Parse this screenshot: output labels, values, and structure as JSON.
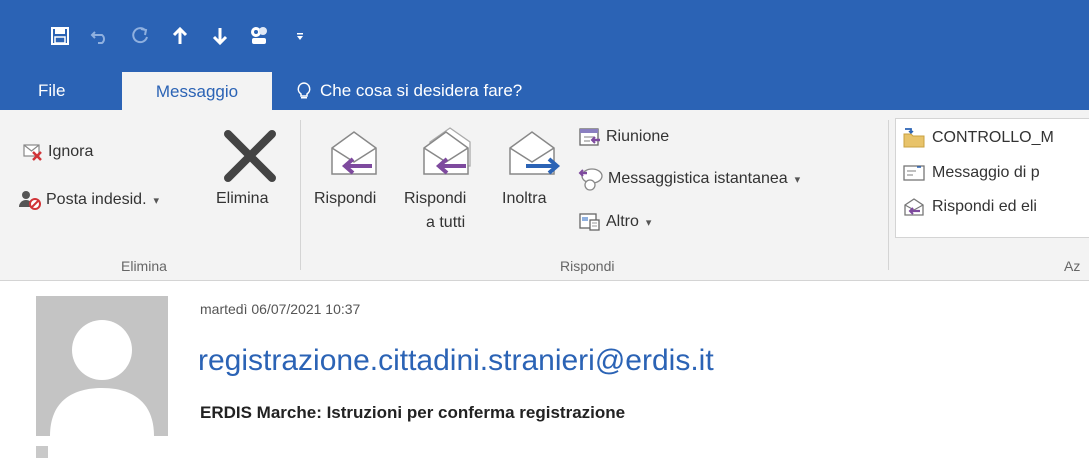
{
  "tabs": {
    "file": "File",
    "messaggio": "Messaggio",
    "tell_me": "Che cosa si desidera fare?"
  },
  "quick_access": [
    "save-icon",
    "undo-icon",
    "redo-icon",
    "arrow-up-icon",
    "arrow-down-icon",
    "touch-mode-icon",
    "customize-icon"
  ],
  "ribbon": {
    "elimina_group": {
      "ignora": "Ignora",
      "posta_indesiderata": "Posta indesid.",
      "elimina": "Elimina",
      "label": "Elimina"
    },
    "rispondi_group": {
      "rispondi": "Rispondi",
      "rispondi_a_tutti_line1": "Rispondi",
      "rispondi_a_tutti_line2": "a tutti",
      "inoltra": "Inoltra",
      "riunione": "Riunione",
      "messaggistica": "Messaggistica istantanea",
      "altro": "Altro",
      "label": "Rispondi"
    },
    "azioni_rapide": {
      "item1": "CONTROLLO_M",
      "item2": "Messaggio di p",
      "item3": "Rispondi ed eli",
      "label": "Az"
    }
  },
  "message": {
    "date": "martedì 06/07/2021 10:37",
    "sender": "registrazione.cittadini.stranieri@erdis.it",
    "subject": "ERDIS Marche: Istruzioni per conferma registrazione"
  },
  "colors": {
    "accent": "#2b63b5",
    "ribbon_bg": "#f3f3f3",
    "delete_red": "#d13438",
    "reply_purple": "#7e4a9e",
    "forward_blue": "#2b63b5"
  }
}
